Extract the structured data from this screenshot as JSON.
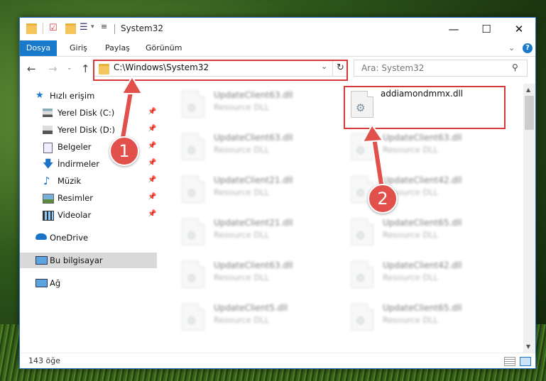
{
  "window": {
    "title": "System32"
  },
  "ribbon": {
    "tabs": [
      "Dosya",
      "Giriş",
      "Paylaş",
      "Görünüm"
    ]
  },
  "address": {
    "path": "C:\\Windows\\System32"
  },
  "search": {
    "placeholder": "Ara: System32"
  },
  "sidebar": {
    "items": [
      {
        "label": "Hızlı erişim"
      },
      {
        "label": "Yerel Disk (C:)"
      },
      {
        "label": "Yerel Disk (D:)"
      },
      {
        "label": "Belgeler"
      },
      {
        "label": "İndirmeler"
      },
      {
        "label": "Müzik"
      },
      {
        "label": "Resimler"
      },
      {
        "label": "Videolar"
      },
      {
        "label": "OneDrive"
      },
      {
        "label": "Bu bilgisayar"
      },
      {
        "label": "Ağ"
      }
    ]
  },
  "files": {
    "highlighted": {
      "name": "addiamondmmx.dll"
    },
    "col1": [
      {
        "name": "UpdateClient63.dll",
        "type": "Resource DLL"
      },
      {
        "name": "UpdateClient63.dll",
        "type": "Resource DLL"
      },
      {
        "name": "UpdateClient21.dll",
        "type": "Resource DLL"
      },
      {
        "name": "UpdateClient21.dll",
        "type": "Resource DLL"
      },
      {
        "name": "UpdateClient63.dll",
        "type": "Resource DLL"
      },
      {
        "name": "UpdateClient5.dll",
        "type": "Resource DLL"
      }
    ],
    "col2": [
      {
        "name": "UpdateClient63.dll",
        "type": "Resource DLL"
      },
      {
        "name": "UpdateClient42.dll",
        "type": "Resource DLL"
      },
      {
        "name": "UpdateClient65.dll",
        "type": "Resource DLL"
      },
      {
        "name": "UpdateClient42.dll",
        "type": "Resource DLL"
      },
      {
        "name": "UpdateClient65.dll",
        "type": "Resource DLL"
      }
    ]
  },
  "status": {
    "count": "143 öğe"
  },
  "annotations": {
    "step1": "1",
    "step2": "2"
  },
  "colors": {
    "accent": "#1979ca",
    "highlight": "#d9383a",
    "badge": "#e2504b"
  }
}
